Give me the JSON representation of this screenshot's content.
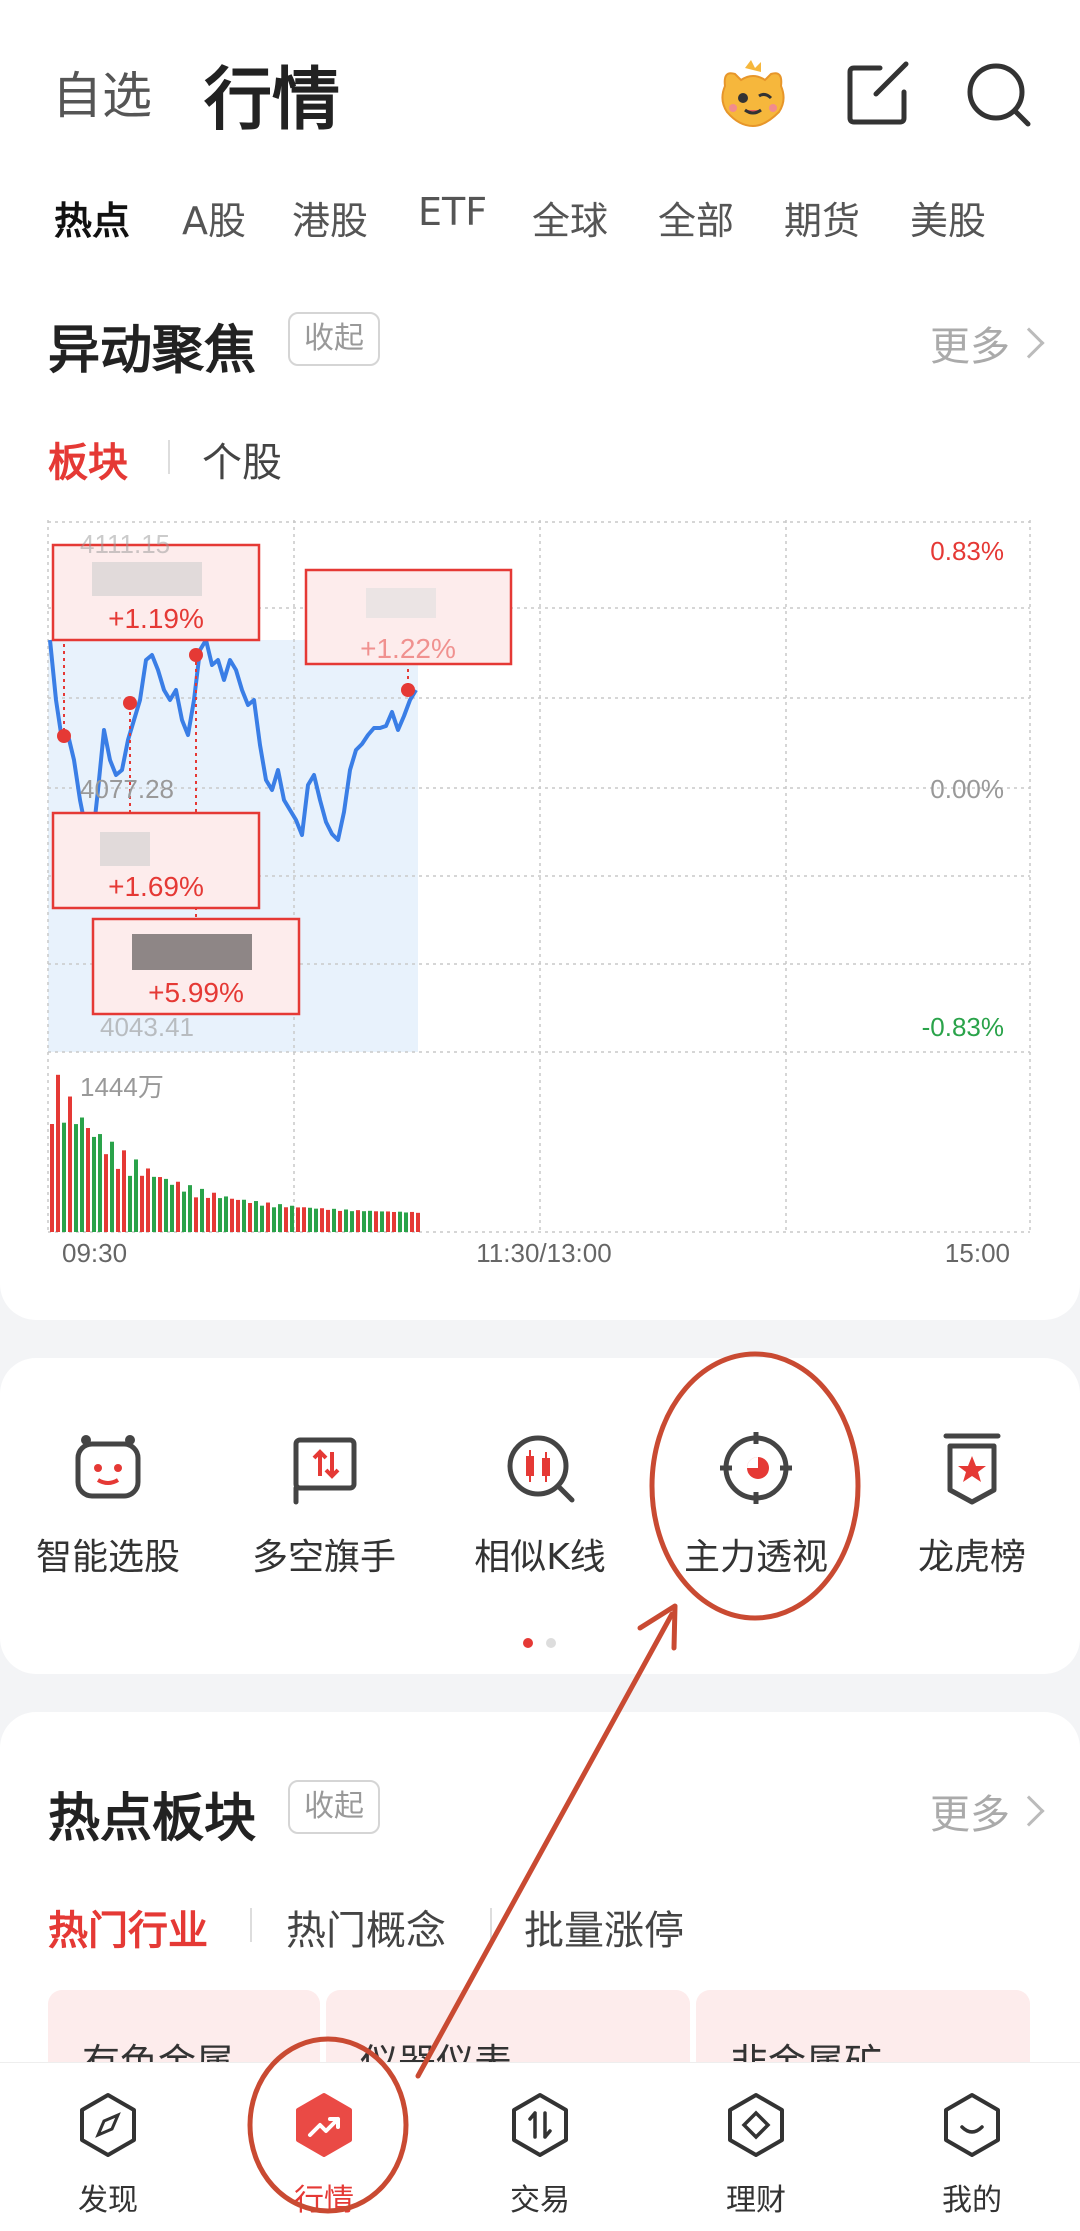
{
  "header": {
    "tab_watchlist": "自选",
    "tab_market": "行情"
  },
  "market_tabs": [
    "热点",
    "A股",
    "港股",
    "ETF",
    "全球",
    "全部",
    "期货",
    "美股"
  ],
  "focus": {
    "title": "异动聚焦",
    "collapse": "收起",
    "more": "更多",
    "subtabs": [
      "板块",
      "个股"
    ]
  },
  "chart_data": {
    "type": "line",
    "y_left_ticks": [
      "4111.15",
      "4077.28",
      "4043.41"
    ],
    "y_right_ticks": [
      "0.83%",
      "0.00%",
      "-0.83%"
    ],
    "x_ticks": [
      "09:30",
      "11:30/13:00",
      "15:00"
    ],
    "volume_label": "1444万",
    "annotations": [
      {
        "change": "+1.19%"
      },
      {
        "change": "+1.22%"
      },
      {
        "change": "+1.69%"
      },
      {
        "change": "+5.99%"
      }
    ],
    "colors": {
      "line": "#3a7ee6",
      "up": "#e53935",
      "down": "#2aa34a"
    }
  },
  "tools": [
    {
      "label": "智能选股",
      "icon": "robot-icon"
    },
    {
      "label": "多空旗手",
      "icon": "long-short-flag-icon"
    },
    {
      "label": "相似K线",
      "icon": "similar-kline-icon"
    },
    {
      "label": "主力透视",
      "icon": "main-force-target-icon"
    },
    {
      "label": "龙虎榜",
      "icon": "dragon-tiger-list-icon"
    }
  ],
  "hot_sectors": {
    "title": "热点板块",
    "collapse": "收起",
    "more": "更多",
    "subtabs": [
      "热门行业",
      "热门概念",
      "批量涨停"
    ],
    "tiles": [
      "有色金属",
      "仪器仪表",
      "非金属矿"
    ]
  },
  "bottom_nav": [
    {
      "label": "发现",
      "icon": "compass-icon"
    },
    {
      "label": "行情",
      "icon": "trend-icon"
    },
    {
      "label": "交易",
      "icon": "exchange-icon"
    },
    {
      "label": "理财",
      "icon": "diamond-icon"
    },
    {
      "label": "我的",
      "icon": "smile-icon"
    }
  ],
  "accent": "#e53935"
}
